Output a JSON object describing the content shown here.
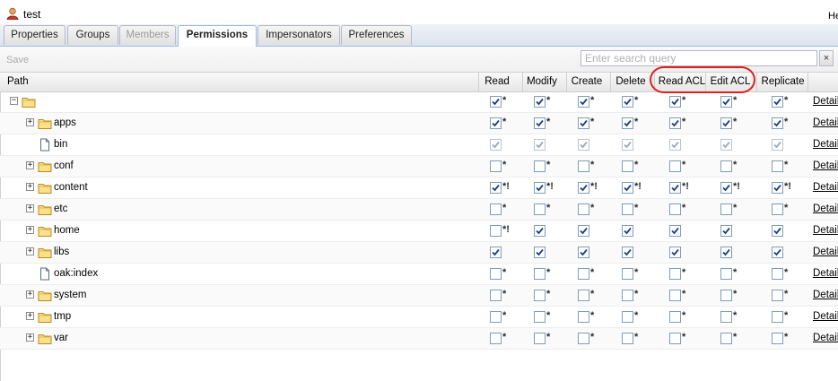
{
  "window": {
    "title": "test",
    "help_label": "He"
  },
  "tabs": [
    {
      "label": "Properties",
      "state": "normal"
    },
    {
      "label": "Groups",
      "state": "normal"
    },
    {
      "label": "Members",
      "state": "disabled"
    },
    {
      "label": "Permissions",
      "state": "active"
    },
    {
      "label": "Impersonators",
      "state": "normal"
    },
    {
      "label": "Preferences",
      "state": "normal"
    }
  ],
  "toolbar": {
    "save_label": "Save"
  },
  "search": {
    "placeholder": "Enter search query",
    "value": "",
    "clear_label": "×"
  },
  "columns": {
    "path": "Path",
    "permissions": [
      "Read",
      "Modify",
      "Create",
      "Delete",
      "Read ACL",
      "Edit ACL",
      "Replicate"
    ],
    "details": ""
  },
  "details_label": "Detail",
  "colors": {
    "annotation": "#e02020",
    "checkmark": "#1a3f8c",
    "tab_border": "#99bbe8"
  },
  "rows": [
    {
      "label": "",
      "icon": "folder-icon",
      "toggle": "minus",
      "level": 0,
      "checked": [
        true,
        true,
        true,
        true,
        true,
        true,
        true
      ],
      "marks": [
        "*",
        "*",
        "*",
        "*",
        "*",
        "*",
        "*"
      ],
      "disabled": false
    },
    {
      "label": "apps",
      "icon": "folder-icon",
      "toggle": "plus",
      "level": 1,
      "checked": [
        true,
        true,
        true,
        true,
        true,
        true,
        true
      ],
      "marks": [
        "*",
        "*",
        "*",
        "*",
        "*",
        "*",
        "*"
      ],
      "disabled": false
    },
    {
      "label": "bin",
      "icon": "file-icon",
      "toggle": "",
      "level": 1,
      "checked": [
        true,
        true,
        true,
        true,
        true,
        true,
        true
      ],
      "marks": [
        "",
        "",
        "",
        "",
        "",
        "",
        ""
      ],
      "disabled": true
    },
    {
      "label": "conf",
      "icon": "folder-icon",
      "toggle": "plus",
      "level": 1,
      "checked": [
        false,
        false,
        false,
        false,
        false,
        false,
        false
      ],
      "marks": [
        "*",
        "*",
        "*",
        "*",
        "*",
        "*",
        "*"
      ],
      "disabled": false
    },
    {
      "label": "content",
      "icon": "folder-icon",
      "toggle": "plus",
      "level": 1,
      "checked": [
        true,
        true,
        true,
        true,
        true,
        true,
        true
      ],
      "marks": [
        "*!",
        "*!",
        "*!",
        "*!",
        "*!",
        "*!",
        "*!"
      ],
      "disabled": false
    },
    {
      "label": "etc",
      "icon": "folder-icon",
      "toggle": "plus",
      "level": 1,
      "checked": [
        false,
        false,
        false,
        false,
        false,
        false,
        false
      ],
      "marks": [
        "*",
        "*",
        "*",
        "*",
        "*",
        "*",
        "*"
      ],
      "disabled": false
    },
    {
      "label": "home",
      "icon": "folder-icon",
      "toggle": "plus",
      "level": 1,
      "checked": [
        false,
        true,
        true,
        true,
        true,
        true,
        true
      ],
      "marks": [
        "*!",
        "",
        "",
        "",
        "",
        "",
        ""
      ],
      "disabled": false
    },
    {
      "label": "libs",
      "icon": "folder-icon",
      "toggle": "plus",
      "level": 1,
      "checked": [
        true,
        true,
        true,
        true,
        true,
        true,
        true
      ],
      "marks": [
        "",
        "",
        "",
        "",
        "",
        "",
        ""
      ],
      "disabled": false
    },
    {
      "label": "oak:index",
      "icon": "file-icon",
      "toggle": "",
      "level": 1,
      "checked": [
        false,
        false,
        false,
        false,
        false,
        false,
        false
      ],
      "marks": [
        "*",
        "*",
        "*",
        "*",
        "*",
        "*",
        "*"
      ],
      "disabled": false
    },
    {
      "label": "system",
      "icon": "folder-icon",
      "toggle": "plus",
      "level": 1,
      "checked": [
        false,
        false,
        false,
        false,
        false,
        false,
        false
      ],
      "marks": [
        "*",
        "*",
        "*",
        "*",
        "*",
        "*",
        "*"
      ],
      "disabled": false
    },
    {
      "label": "tmp",
      "icon": "folder-icon",
      "toggle": "plus",
      "level": 1,
      "checked": [
        false,
        false,
        false,
        false,
        false,
        false,
        false
      ],
      "marks": [
        "*",
        "*",
        "*",
        "*",
        "*",
        "*",
        "*"
      ],
      "disabled": false
    },
    {
      "label": "var",
      "icon": "folder-icon",
      "toggle": "plus",
      "level": 1,
      "checked": [
        false,
        false,
        false,
        false,
        false,
        false,
        false
      ],
      "marks": [
        "*",
        "*",
        "*",
        "*",
        "*",
        "*",
        "*"
      ],
      "disabled": false
    }
  ]
}
